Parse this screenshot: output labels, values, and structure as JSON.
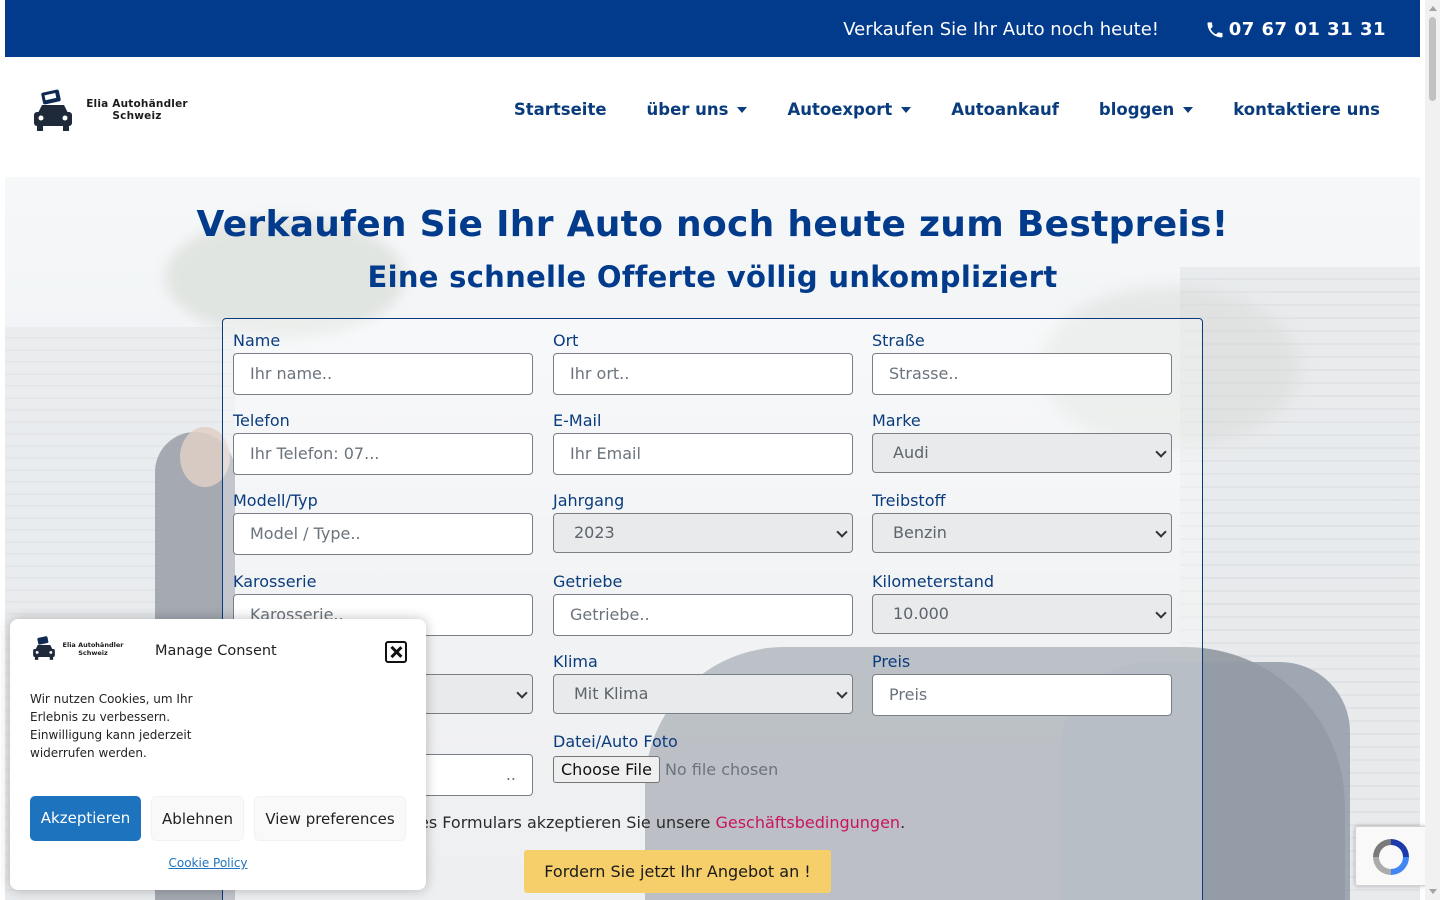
{
  "topbar": {
    "tagline": "Verkaufen Sie Ihr Auto noch heute!",
    "phone": "07 67 01 31 31",
    "phone_icon": "phone-icon"
  },
  "header": {
    "logo_text_line1": "Elia Autohändler",
    "logo_text_line2": "Schweiz",
    "nav": [
      {
        "label": "Startseite",
        "has_dropdown": false
      },
      {
        "label": "über uns",
        "has_dropdown": true
      },
      {
        "label": "Autoexport",
        "has_dropdown": true
      },
      {
        "label": "Autoankauf",
        "has_dropdown": false
      },
      {
        "label": "bloggen",
        "has_dropdown": true
      },
      {
        "label": "kontaktiere uns",
        "has_dropdown": false
      }
    ]
  },
  "hero": {
    "title": "Verkaufen Sie Ihr Auto noch heute zum Bestpreis!",
    "subtitle": "Eine schnelle Offerte völlig unkompliziert"
  },
  "form": {
    "name": {
      "label": "Name",
      "placeholder": "Ihr name.."
    },
    "ort": {
      "label": "Ort",
      "placeholder": "Ihr ort.."
    },
    "strasse": {
      "label": "Straße",
      "placeholder": "Strasse.."
    },
    "telefon": {
      "label": "Telefon",
      "placeholder": "Ihr Telefon: 07..."
    },
    "email": {
      "label": "E-Mail",
      "placeholder": "Ihr Email"
    },
    "marke": {
      "label": "Marke",
      "value": "Audi"
    },
    "modell": {
      "label": "Modell/Typ",
      "placeholder": "Model / Type.."
    },
    "jahrgang": {
      "label": "Jahrgang",
      "value": "2023"
    },
    "treibstoff": {
      "label": "Treibstoff",
      "value": "Benzin"
    },
    "karosserie": {
      "label": "Karosserie",
      "placeholder": "Karosserie.."
    },
    "getriebe": {
      "label": "Getriebe",
      "placeholder": "Getriebe.."
    },
    "kilometerstand": {
      "label": "Kilometerstand",
      "value": "10.000"
    },
    "klima": {
      "label": "Klima",
      "value": "Mit Klima"
    },
    "preis": {
      "label": "Preis",
      "placeholder": "Preis"
    },
    "foto": {
      "label": "Datei/Auto Foto",
      "button": "Choose File",
      "status": "No file chosen"
    },
    "partial_input_placeholder": "..",
    "terms_text": "es Formulars akzeptieren Sie unsere",
    "terms_link": "Geschäftsbedingungen",
    "terms_end": ".",
    "submit": "Fordern Sie jetzt Ihr Angebot an !"
  },
  "consent": {
    "logo_text_line1": "Elia Autohändler",
    "logo_text_line2": "Schweiz",
    "title": "Manage Consent",
    "text": "Wir nutzen Cookies, um Ihr Erlebnis zu verbessern. Einwilligung kann jederzeit widerrufen werden.",
    "accept": "Akzeptieren",
    "deny": "Ablehnen",
    "preferences": "View preferences",
    "policy": "Cookie Policy"
  },
  "colors": {
    "brand_blue": "#023a8c",
    "accent_yellow": "#f7cf6a",
    "link_pink": "#c8155c",
    "consent_blue": "#1e73be"
  }
}
